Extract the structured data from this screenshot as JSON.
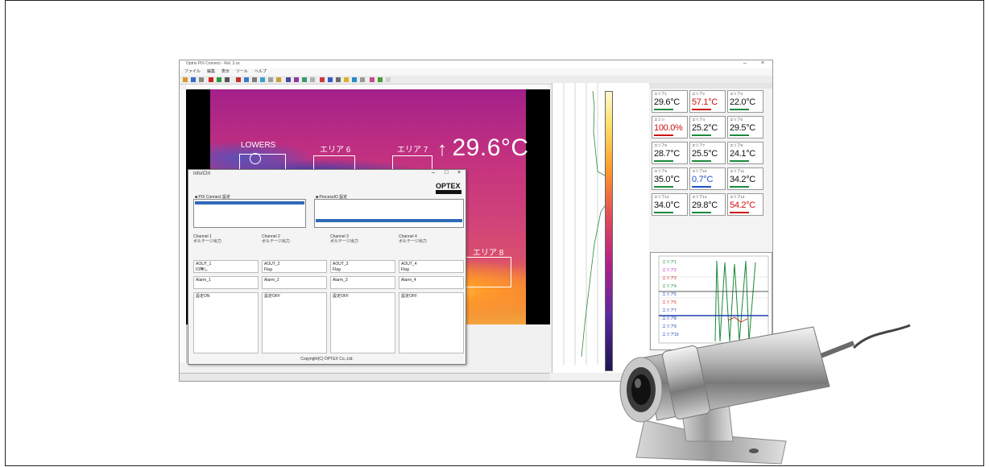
{
  "window": {
    "title": "Optris PIX Connect - Rel. 3.xx"
  },
  "menubar": {
    "items": [
      "ファイル",
      "編集",
      "表示",
      "ツール",
      "ヘルプ"
    ]
  },
  "thermal": {
    "big_reading": "29.6°C",
    "arrow": "↑",
    "rois": [
      "エリア 6",
      "エリア 7",
      "エリア 8"
    ],
    "hotspot_label": "LOWERS"
  },
  "measure_grid": {
    "cells": [
      {
        "label": "エリア1",
        "value": "29.6°C",
        "color": "#111111"
      },
      {
        "label": "エリア2",
        "value": "57.1°C",
        "color": "#d01010"
      },
      {
        "label": "エリア3",
        "value": "22.0°C",
        "color": "#111111"
      },
      {
        "label": "エミシ",
        "value": "100.0%",
        "color": "#d01010"
      },
      {
        "label": "エリア4",
        "value": "25.2°C",
        "color": "#111111"
      },
      {
        "label": "エリア5",
        "value": "29.5°C",
        "color": "#111111"
      },
      {
        "label": "エリア6",
        "value": "28.7°C",
        "color": "#111111"
      },
      {
        "label": "エリア7",
        "value": "25.5°C",
        "color": "#111111"
      },
      {
        "label": "エリア8",
        "value": "24.1°C",
        "color": "#111111"
      },
      {
        "label": "エリア9",
        "value": "35.0°C",
        "color": "#111111"
      },
      {
        "label": "エリア10",
        "value": "0.7°C",
        "color": "#1c50c8"
      },
      {
        "label": "エリア11",
        "value": "34.2°C",
        "color": "#111111"
      },
      {
        "label": "エリア12",
        "value": "34.0°C",
        "color": "#111111"
      },
      {
        "label": "エリア13",
        "value": "29.8°C",
        "color": "#111111"
      },
      {
        "label": "エリア14",
        "value": "54.2°C",
        "color": "#d01010"
      }
    ]
  },
  "trend": {
    "legend": [
      "エリア1",
      "エリア2",
      "エリア3",
      "エリア4",
      "エリア5",
      "エリア6",
      "エリア7",
      "エリア8",
      "エリア9",
      "エリア10"
    ]
  },
  "dialog": {
    "title": "Info/Ctrl",
    "brand": "OPTEX",
    "footer": "Copyright(C) OPTEX Co.,Ltd.",
    "list_left_title": "■ PIX Connect 設定",
    "list_right_title": "■ ProcessIO 設定",
    "columns": [
      {
        "head": "Channel 1",
        "sub": "ボルテージ出力",
        "box1": "AOUT_1",
        "box2": "IO無し",
        "alarm": "Alarm_1",
        "tail": "設定ON"
      },
      {
        "head": "Channel 2",
        "sub": "ボルテージ出力",
        "box1": "AOUT_2",
        "box2": "Flag",
        "alarm": "Alarm_2",
        "tail": "設定OFF"
      },
      {
        "head": "Channel 3",
        "sub": "ボルテージ出力",
        "box1": "AOUT_3",
        "box2": "Flag",
        "alarm": "Alarm_3",
        "tail": "設定OFF"
      },
      {
        "head": "Channel 4",
        "sub": "ボルテージ出力",
        "box1": "AOUT_4",
        "box2": "Flag",
        "alarm": "Alarm_4",
        "tail": "設定OFF"
      }
    ]
  },
  "colors": {
    "accent": "#2f6ab8",
    "alarm": "#d01010"
  }
}
